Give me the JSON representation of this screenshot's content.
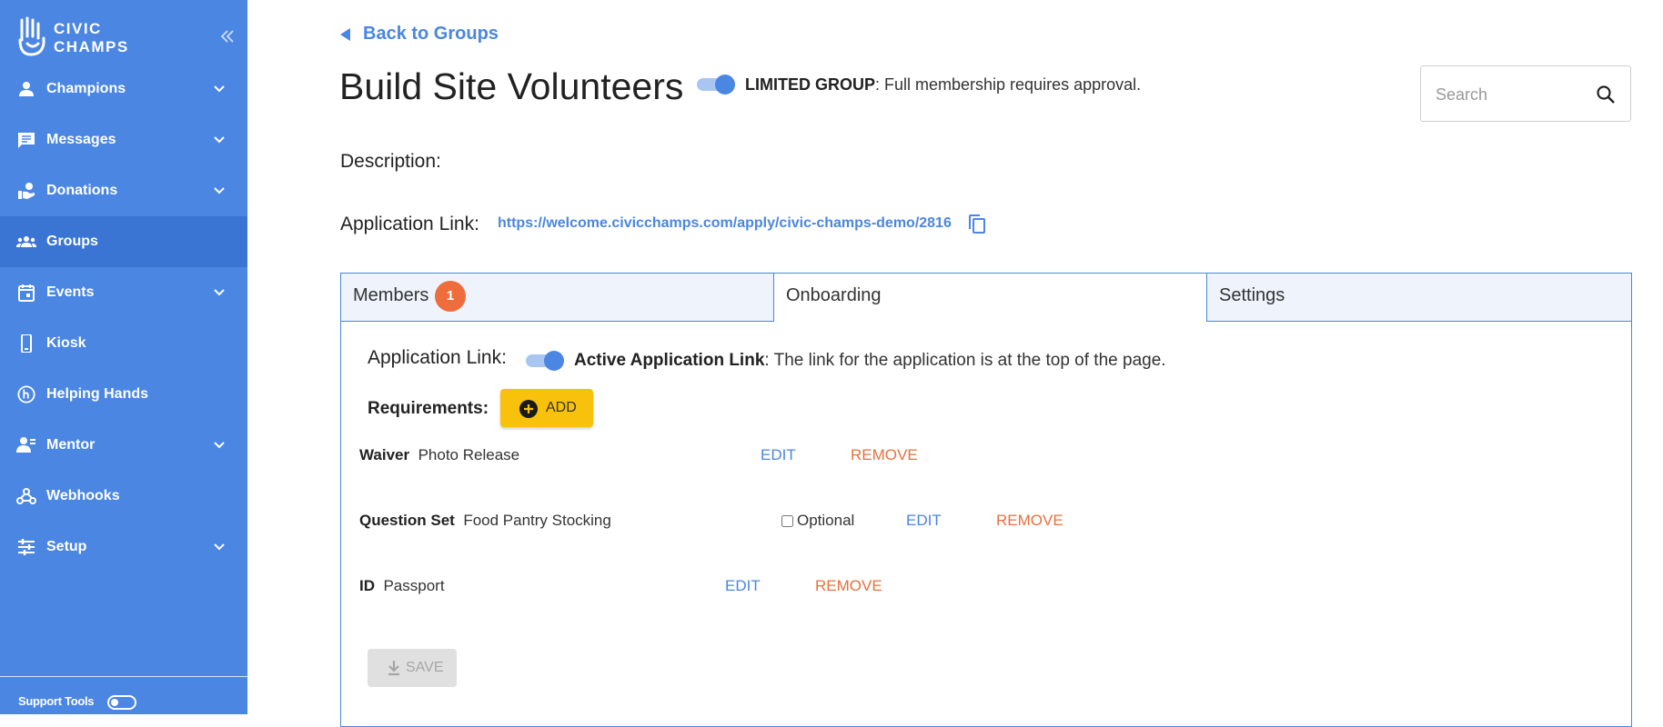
{
  "brand": {
    "line1": "CIVIC",
    "line2": "CHAMPS"
  },
  "sidebar": {
    "items": [
      {
        "label": "Champions",
        "icon": "person-icon",
        "has_submenu": true
      },
      {
        "label": "Messages",
        "icon": "chat-icon",
        "has_submenu": true
      },
      {
        "label": "Donations",
        "icon": "donation-hand-icon",
        "has_submenu": true
      },
      {
        "label": "Groups",
        "icon": "groups-icon",
        "has_submenu": false,
        "active": true
      },
      {
        "label": "Events",
        "icon": "calendar-icon",
        "has_submenu": true
      },
      {
        "label": "Kiosk",
        "icon": "phone-icon",
        "has_submenu": false
      },
      {
        "label": "Helping Hands",
        "icon": "helping-hands-icon",
        "has_submenu": false
      },
      {
        "label": "Mentor",
        "icon": "mentor-icon",
        "has_submenu": true
      },
      {
        "label": "Webhooks",
        "icon": "webhook-icon",
        "has_submenu": false
      },
      {
        "label": "Setup",
        "icon": "sliders-icon",
        "has_submenu": true
      }
    ],
    "support_tools_label": "Support Tools",
    "support_tools_enabled": false
  },
  "header": {
    "back_label": "Back to Groups",
    "title": "Build Site Volunteers",
    "limited_group_bold": "LIMITED GROUP",
    "limited_group_text": ": Full membership requires approval.",
    "limited_group_enabled": true
  },
  "search": {
    "placeholder": "Search",
    "value": ""
  },
  "details": {
    "description_label": "Description:",
    "application_link_label": "Application Link:",
    "application_link_url": "https://welcome.civicchamps.com/apply/civic-champs-demo/2816"
  },
  "tabs": [
    {
      "label": "Members",
      "badge": "1"
    },
    {
      "label": "Onboarding",
      "active": true
    },
    {
      "label": "Settings"
    }
  ],
  "onboarding": {
    "application_link_label": "Application Link:",
    "active_link_bold": "Active Application Link",
    "active_link_text": ": The link for the application is at the top of the page.",
    "active_link_enabled": true,
    "requirements_label": "Requirements:",
    "add_label": "ADD",
    "requirements": [
      {
        "type": "Waiver",
        "name": "Photo Release",
        "edit": "EDIT",
        "remove": "REMOVE"
      },
      {
        "type": "Question Set",
        "name": "Food Pantry Stocking",
        "optional_label": "Optional",
        "optional_checked": false,
        "edit": "EDIT",
        "remove": "REMOVE"
      },
      {
        "type": "ID",
        "name": "Passport",
        "edit": "EDIT",
        "remove": "REMOVE"
      }
    ],
    "save_label": "SAVE"
  },
  "colors": {
    "sidebar": "#4a86e2",
    "active_nav": "#3a75d3",
    "accent": "#4a86e2",
    "badge": "#ef6c3c",
    "add_button": "#f8c20c",
    "remove": "#e8703b"
  }
}
